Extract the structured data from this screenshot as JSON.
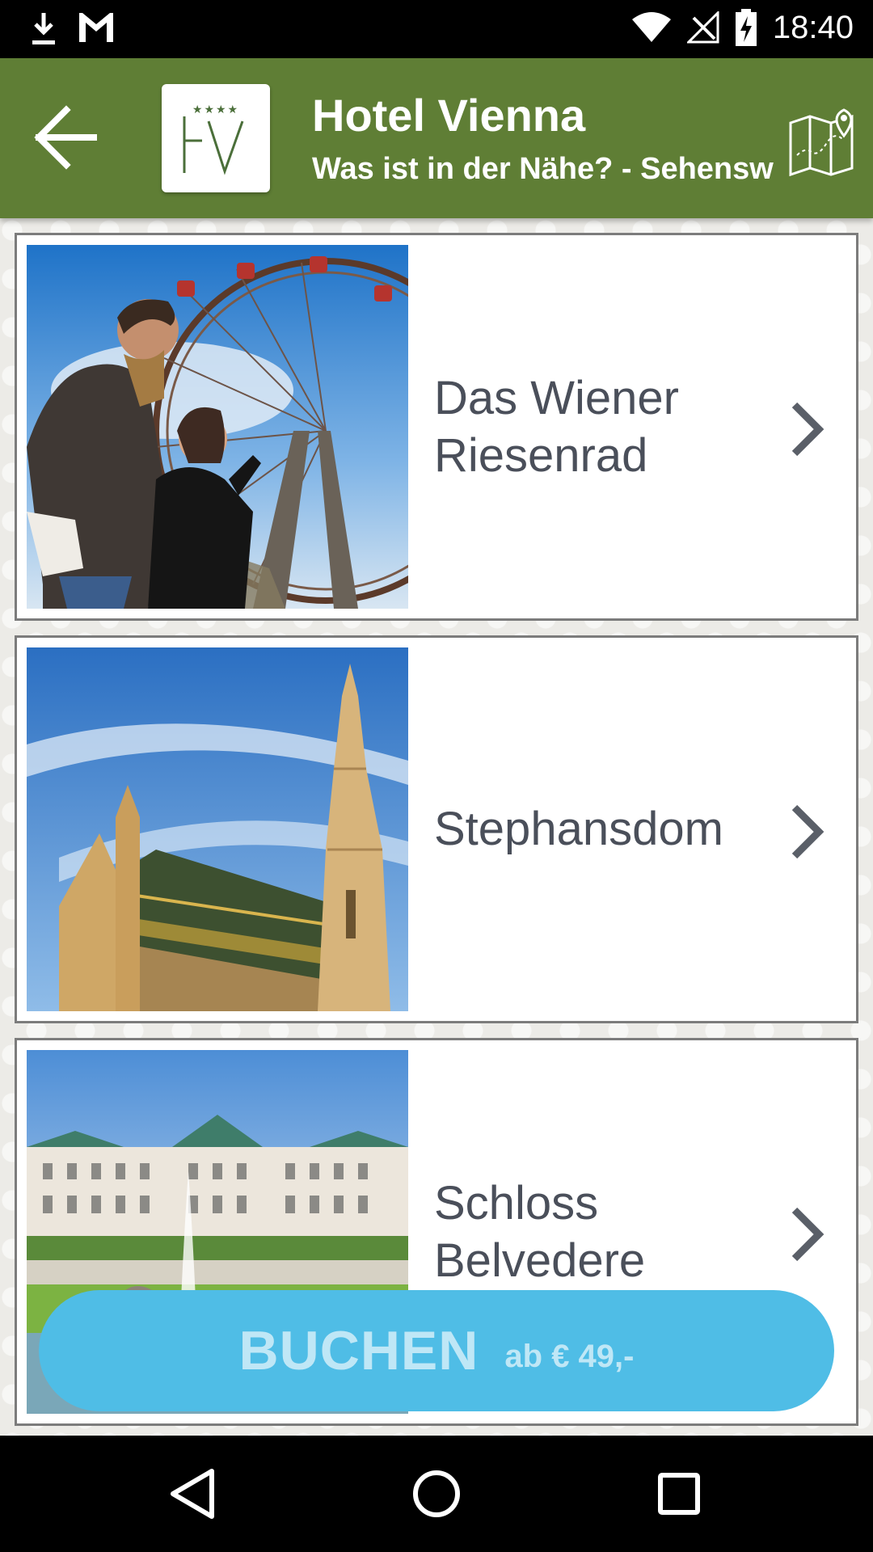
{
  "status_bar": {
    "time": "18:40",
    "icons": [
      "download-icon",
      "gmail-icon",
      "wifi-icon",
      "signal-icon",
      "battery-charging-icon"
    ]
  },
  "toolbar": {
    "title": "Hotel Vienna",
    "subtitle": "Was ist in der Nähe? - Sehensw",
    "logo_text": "HV",
    "logo_stars": "★★★★",
    "back_icon": "arrow-left-icon",
    "map_icon": "map-pin-icon"
  },
  "places": [
    {
      "name": "Das Wiener Riesenrad",
      "image": "ferris-wheel-photo"
    },
    {
      "name": "Stephansdom",
      "image": "cathedral-photo"
    },
    {
      "name": "Schloss Belvedere",
      "image": "palace-photo"
    }
  ],
  "book_button": {
    "label": "BUCHEN",
    "price": "ab € 49,-"
  },
  "nav_bar": {
    "icons": [
      "back-triangle-icon",
      "home-circle-icon",
      "recents-square-icon"
    ]
  },
  "colors": {
    "toolbar": "#5f7e35",
    "book_button": "#4fbde6",
    "text": "#4a4f5a"
  }
}
